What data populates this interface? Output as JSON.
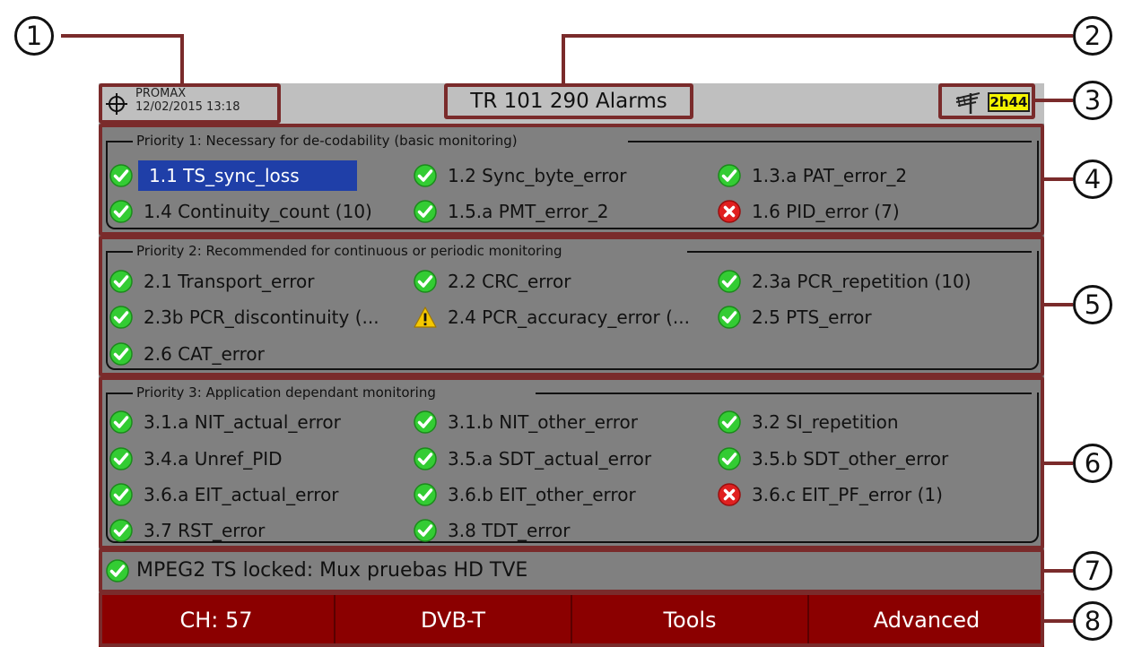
{
  "header": {
    "brand": "PROMAX",
    "datetime": "12/02/2015 13:18",
    "title": "TR 101 290 Alarms",
    "battery": "2h44"
  },
  "priority1": {
    "title": "Priority 1: Necessary for de-codability (basic monitoring)",
    "items": [
      {
        "label": "1.1 TS_sync_loss",
        "status": "ok"
      },
      {
        "label": "1.2 Sync_byte_error",
        "status": "ok"
      },
      {
        "label": "1.3.a PAT_error_2",
        "status": "ok"
      },
      {
        "label": "1.4 Continuity_count (10)",
        "status": "ok"
      },
      {
        "label": "1.5.a PMT_error_2",
        "status": "ok"
      },
      {
        "label": "1.6 PID_error (7)",
        "status": "error"
      }
    ]
  },
  "priority2": {
    "title": "Priority 2: Recommended for continuous or periodic monitoring",
    "items": [
      {
        "label": "2.1 Transport_error",
        "status": "ok"
      },
      {
        "label": "2.2 CRC_error",
        "status": "ok"
      },
      {
        "label": "2.3a PCR_repetition (10)",
        "status": "ok"
      },
      {
        "label": "2.3b PCR_discontinuity (...",
        "status": "ok"
      },
      {
        "label": "2.4 PCR_accuracy_error (...",
        "status": "warning"
      },
      {
        "label": "2.5 PTS_error",
        "status": "ok"
      },
      {
        "label": "2.6 CAT_error",
        "status": "ok"
      }
    ]
  },
  "priority3": {
    "title": "Priority 3: Application dependant monitoring",
    "items": [
      {
        "label": "3.1.a NIT_actual_error",
        "status": "ok"
      },
      {
        "label": "3.1.b NIT_other_error",
        "status": "ok"
      },
      {
        "label": "3.2 SI_repetition",
        "status": "ok"
      },
      {
        "label": "3.4.a Unref_PID",
        "status": "ok"
      },
      {
        "label": "3.5.a SDT_actual_error",
        "status": "ok"
      },
      {
        "label": "3.5.b SDT_other_error",
        "status": "ok"
      },
      {
        "label": "3.6.a EIT_actual_error",
        "status": "ok"
      },
      {
        "label": "3.6.b EIT_other_error",
        "status": "ok"
      },
      {
        "label": "3.6.c EIT_PF_error (1)",
        "status": "error"
      },
      {
        "label": "3.7 RST_error",
        "status": "ok"
      },
      {
        "label": "3.8 TDT_error",
        "status": "ok"
      }
    ]
  },
  "status": {
    "text": "MPEG2 TS locked: Mux pruebas HD TVE",
    "state": "ok"
  },
  "softkeys": [
    "CH: 57",
    "DVB-T",
    "Tools",
    "Advanced"
  ],
  "callouts": [
    "1",
    "2",
    "3",
    "4",
    "5",
    "6",
    "7",
    "8"
  ],
  "colors": {
    "selection": "#1f3fa8",
    "softkey_bar": "#8b0000",
    "battery": "#f5f500",
    "callout_border": "#7a2b2b",
    "ok": "#33cc33",
    "error": "#e02020",
    "warning": "#f5c800"
  }
}
